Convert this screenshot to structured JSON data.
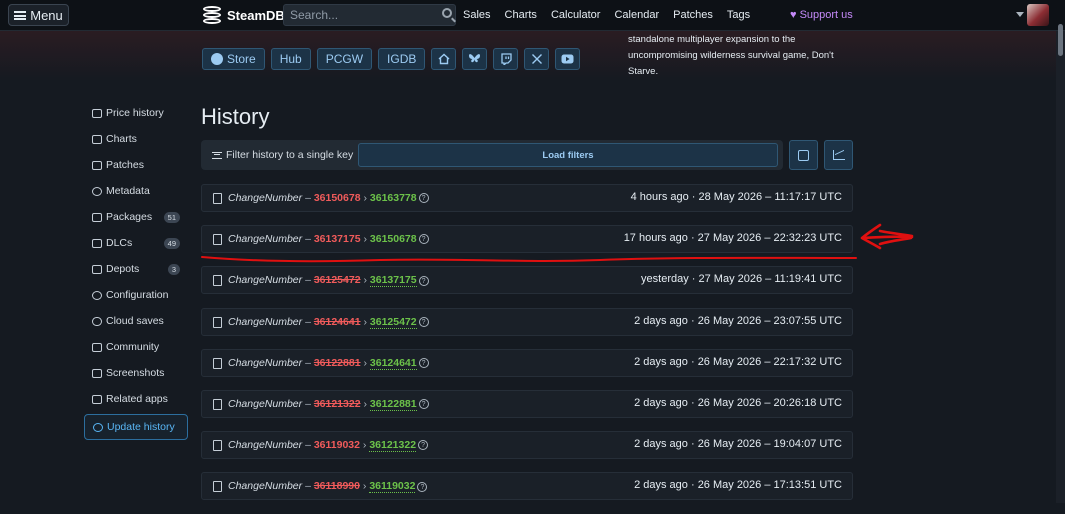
{
  "topbar": {
    "menu_label": "Menu",
    "logo_text": "SteamDB",
    "search_placeholder": "Search...",
    "nav": [
      "Sales",
      "Charts",
      "Calculator",
      "Calendar",
      "Patches",
      "Tags"
    ],
    "support_label": "♥ Support us"
  },
  "header": {
    "pills": [
      "Store",
      "Hub",
      "PCGW",
      "IGDB"
    ],
    "icon_pills": [
      "home-icon",
      "bluesky-icon",
      "twitch-icon",
      "x-icon",
      "youtube-icon"
    ],
    "description": "standalone multiplayer expansion to the uncompromising wilderness survival game, Don't Starve."
  },
  "sidebar": {
    "items": [
      {
        "label": "Price history",
        "icon": "price-icon",
        "badge": ""
      },
      {
        "label": "Charts",
        "icon": "chart-icon",
        "badge": ""
      },
      {
        "label": "Patches",
        "icon": "patches-icon",
        "badge": ""
      },
      {
        "label": "Metadata",
        "icon": "info-icon",
        "badge": ""
      },
      {
        "label": "Packages",
        "icon": "package-icon",
        "badge": "51"
      },
      {
        "label": "DLCs",
        "icon": "dlc-icon",
        "badge": "49"
      },
      {
        "label": "Depots",
        "icon": "depot-icon",
        "badge": "3"
      },
      {
        "label": "Configuration",
        "icon": "gear-icon",
        "badge": ""
      },
      {
        "label": "Cloud saves",
        "icon": "cloud-icon",
        "badge": ""
      },
      {
        "label": "Community",
        "icon": "community-icon",
        "badge": ""
      },
      {
        "label": "Screenshots",
        "icon": "image-icon",
        "badge": ""
      },
      {
        "label": "Related apps",
        "icon": "link-icon",
        "badge": ""
      },
      {
        "label": "Update history",
        "icon": "history-icon",
        "badge": ""
      }
    ]
  },
  "main": {
    "title": "History",
    "filter_label": "Filter history to a single key",
    "load_filters_label": "Load filters"
  },
  "history": {
    "label": "ChangeNumber",
    "rows": [
      {
        "old": "36150678",
        "new": "36163778",
        "when": "4 hours ago · 28 May 2026 – 11:17:17 UTC"
      },
      {
        "old": "36137175",
        "new": "36150678",
        "when": "17 hours ago · 27 May 2026 – 22:32:23 UTC"
      },
      {
        "old": "36125472",
        "new": "36137175",
        "when": "yesterday · 27 May 2026 – 11:19:41 UTC"
      },
      {
        "old": "36124641",
        "new": "36125472",
        "when": "2 days ago · 26 May 2026 – 23:07:55 UTC"
      },
      {
        "old": "36122881",
        "new": "36124641",
        "when": "2 days ago · 26 May 2026 – 22:17:32 UTC"
      },
      {
        "old": "36121322",
        "new": "36122881",
        "when": "2 days ago · 26 May 2026 – 20:26:18 UTC"
      },
      {
        "old": "36119032",
        "new": "36121322",
        "when": "2 days ago · 26 May 2026 – 19:04:07 UTC"
      },
      {
        "old": "36118990",
        "new": "36119032",
        "when": "2 days ago · 26 May 2026 – 17:13:51 UTC"
      }
    ]
  },
  "colors": {
    "accent": "#59b6f5",
    "old_change": "#f05b5b",
    "new_change": "#6cc24a",
    "annotation": "#e01010"
  }
}
